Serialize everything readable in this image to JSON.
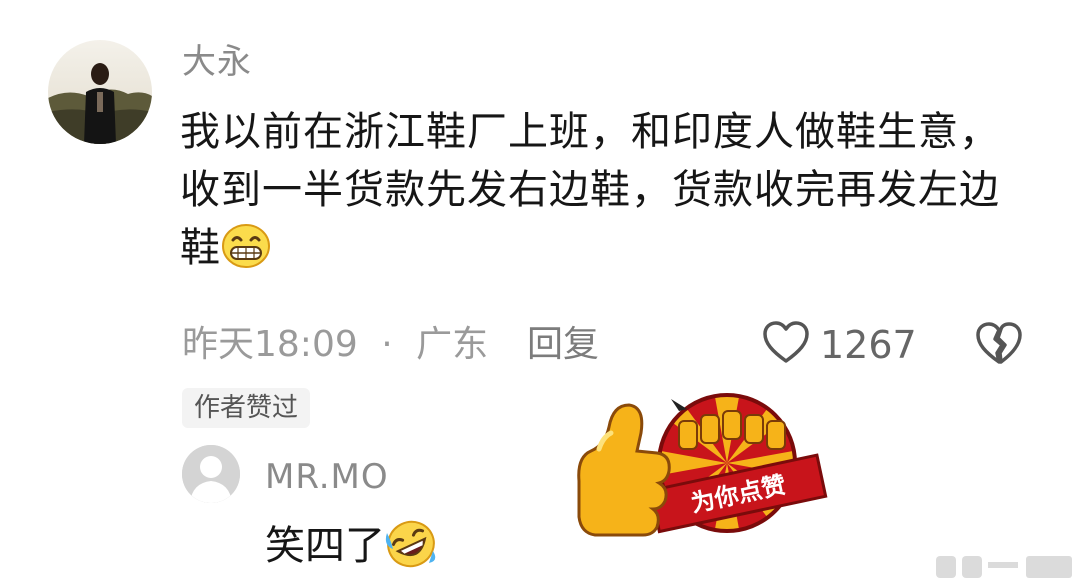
{
  "comment": {
    "username": "大永",
    "text": "我以前在浙江鞋厂上班，和印度人做鞋生意，收到一半货款先发右边鞋，货款收完再发左边鞋",
    "emoji": "grinning-face-icon",
    "time": "昨天18:09",
    "separator": "·",
    "location": "广东",
    "reply_label": "回复",
    "like_count": "1267",
    "author_liked_badge": "作者赞过"
  },
  "sub_reply": {
    "username": "MR.MO",
    "text": "笑四了",
    "emoji": "rolling-on-floor-laughing-icon"
  },
  "sticker": {
    "text": "为你点赞",
    "colors": {
      "red": "#c8141b",
      "gold": "#f6b319",
      "dark_red": "#7a0b0b"
    }
  },
  "colors": {
    "meta_gray": "#9a9a9a",
    "text": "#161616",
    "badge_bg": "#f3f3f3"
  }
}
